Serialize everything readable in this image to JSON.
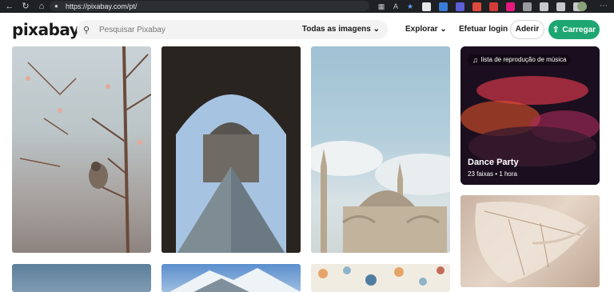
{
  "browser": {
    "url": "https://pixabay.com/pt/",
    "nav_icons": [
      "back-icon",
      "refresh-icon",
      "home-icon"
    ],
    "address_icons": [
      "tab-grid-icon",
      "read-aloud-icon",
      "favorite-star-icon"
    ]
  },
  "header": {
    "logo": "pixabay",
    "search_placeholder": "Pesquisar Pixabay",
    "filter_label": "Todas as imagens",
    "explore_label": "Explorar",
    "login_label": "Efetuar login",
    "join_label": "Aderir",
    "upload_label": "Carregar",
    "colors": {
      "accent": "#1ea672"
    }
  },
  "music_card": {
    "badge": "lista de reprodução de música",
    "title": "Dance Party",
    "tracks": "23 faixas",
    "separator": "•",
    "duration": "1 hora"
  },
  "gallery": {
    "tiles": [
      "bird-on-branch-photo",
      "louvre-pyramid-photo",
      "mosque-photo",
      "dance-party-music-card",
      "dried-leaf-photo",
      "lake-photo",
      "snowy-mountain-photo",
      "floral-pattern-photo"
    ]
  }
}
